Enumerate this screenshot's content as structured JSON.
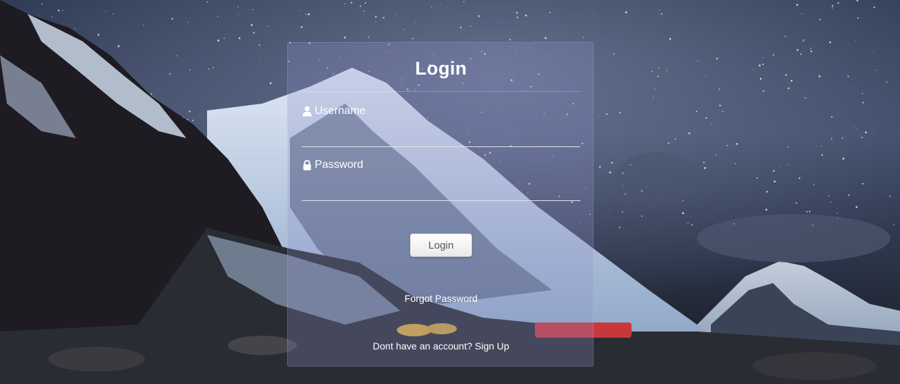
{
  "login": {
    "title": "Login",
    "username_label": "Username",
    "username_value": "",
    "password_label": "Password",
    "password_value": "",
    "submit_label": "Login",
    "forgot_password": "Forgot Password",
    "signup_prompt": "Dont have an account? Sign Up"
  },
  "icons": {
    "username": "user-icon",
    "password": "lock-icon"
  }
}
